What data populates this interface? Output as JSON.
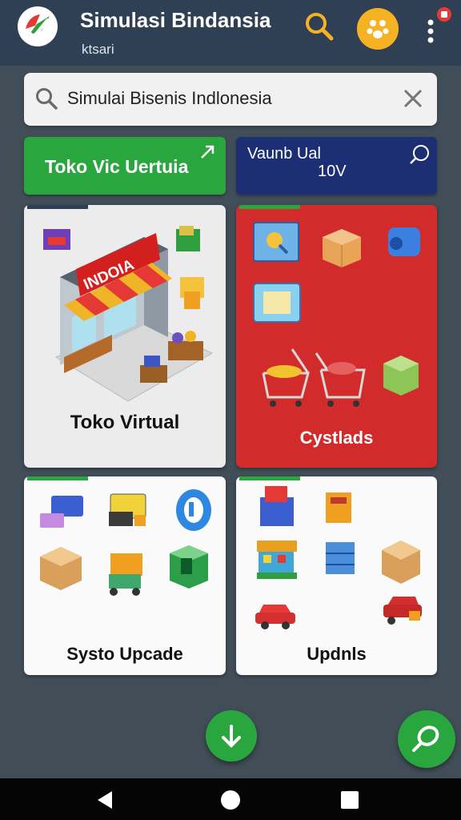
{
  "app": {
    "title": "Simulasi Bindansia",
    "subtitle": "ktsari"
  },
  "search": {
    "value": "Simulai Bisenis Indlonesia"
  },
  "quick_actions": {
    "virtual_store_label": "Toko Vic Uertuia",
    "virtual_line1": "Vaunb Ual",
    "virtual_line2": "10V"
  },
  "cards": [
    {
      "label": "Toko Virtual"
    },
    {
      "label": "Cystlads"
    },
    {
      "label": "Systo Upcade"
    },
    {
      "label": "Updnls"
    }
  ],
  "storefront_sign": "INDOIA",
  "colors": {
    "appbar": "#2f3f54",
    "green": "#2aa63e",
    "navy": "#1c2e74",
    "red": "#d12b2b",
    "yellow": "#f5b324"
  }
}
